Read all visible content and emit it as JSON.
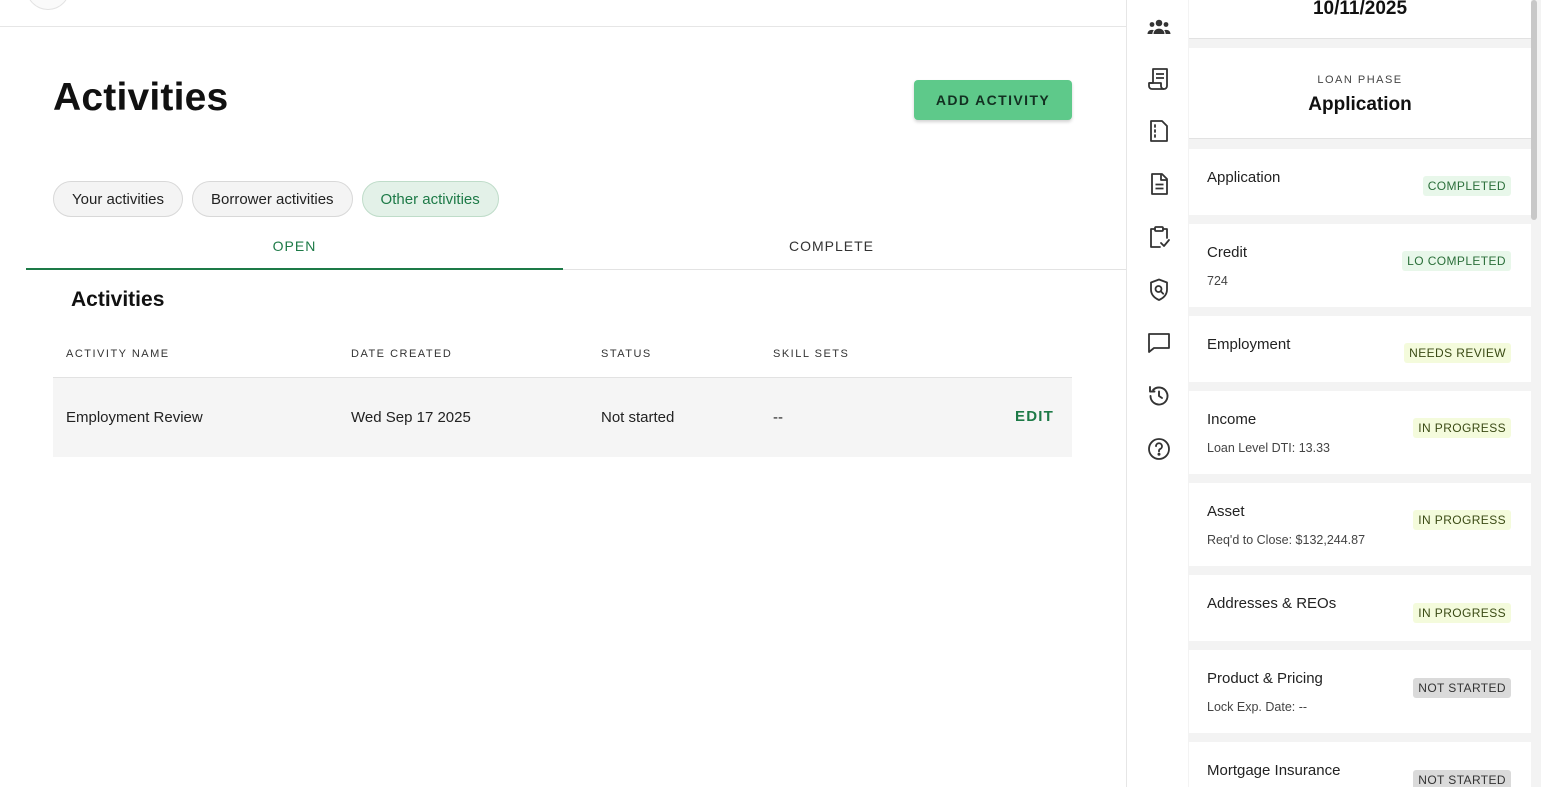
{
  "main": {
    "title": "Activities",
    "add_button_label": "ADD ACTIVITY",
    "chips": [
      {
        "label": "Your activities"
      },
      {
        "label": "Borrower activities"
      },
      {
        "label": "Other activities"
      }
    ],
    "tabs": [
      {
        "label": "OPEN"
      },
      {
        "label": "COMPLETE"
      }
    ],
    "section_title": "Activities",
    "table": {
      "columns": [
        "ACTIVITY NAME",
        "DATE CREATED",
        "STATUS",
        "SKILL SETS"
      ],
      "rows": [
        {
          "name": "Employment Review",
          "date": "Wed Sep 17 2025",
          "status": "Not started",
          "skills": "--",
          "action": "EDIT"
        }
      ]
    }
  },
  "rail": {
    "icons": [
      "team-icon",
      "receipt-icon",
      "document-outline-icon",
      "file-text-icon",
      "clipboard-check-icon",
      "shield-search-icon",
      "chat-icon",
      "history-icon",
      "help-icon"
    ]
  },
  "panel": {
    "date": "10/11/2025",
    "phase_label": "LOAN PHASE",
    "phase_value": "Application",
    "items": [
      {
        "title": "Application",
        "sub": "",
        "badge": "COMPLETED"
      },
      {
        "title": "Credit",
        "sub": "724",
        "badge": "LO COMPLETED"
      },
      {
        "title": "Employment",
        "sub": "",
        "badge": "NEEDS REVIEW"
      },
      {
        "title": "Income",
        "sub": "Loan Level DTI: 13.33",
        "badge": "IN PROGRESS"
      },
      {
        "title": "Asset",
        "sub": "Req'd to Close: $132,244.87",
        "badge": "IN PROGRESS"
      },
      {
        "title": "Addresses & REOs",
        "sub": "",
        "badge": "IN PROGRESS"
      },
      {
        "title": "Product & Pricing",
        "sub": "Lock Exp. Date: --",
        "badge": "NOT STARTED"
      },
      {
        "title": "Mortgage Insurance",
        "sub": "",
        "badge": "NOT STARTED"
      }
    ]
  }
}
